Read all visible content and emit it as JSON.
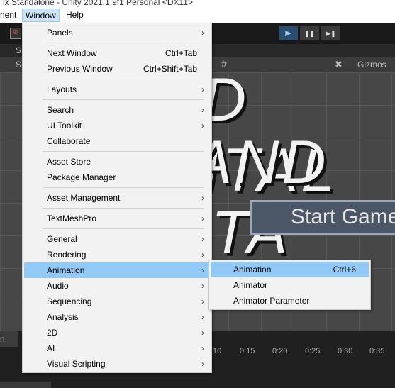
{
  "window_title": "ix Standalone - Unity 2021.1.9f1 Personal <DX11>",
  "menubar": [
    "nent",
    "Window",
    "Help"
  ],
  "toolbar": {
    "play": "▶",
    "pause": "❚❚",
    "step": "▶❚"
  },
  "scene": {
    "tab": "S",
    "gizmos": "Gizmos",
    "title_line1": "D ITAL",
    "title_line2": "AND ITA",
    "button": "Start Game"
  },
  "bottom": {
    "tab": "n",
    "ticks": [
      "10",
      "0:15",
      "0:20",
      "0:25",
      "0:30",
      "0:35"
    ]
  },
  "window_menu": {
    "items": [
      {
        "label": "Panels",
        "submenu": true
      },
      {
        "sep": true
      },
      {
        "label": "Next Window",
        "shortcut": "Ctrl+Tab"
      },
      {
        "label": "Previous Window",
        "shortcut": "Ctrl+Shift+Tab"
      },
      {
        "sep": true
      },
      {
        "label": "Layouts",
        "submenu": true
      },
      {
        "sep": true
      },
      {
        "label": "Search",
        "submenu": true
      },
      {
        "label": "UI Toolkit",
        "submenu": true
      },
      {
        "label": "Collaborate"
      },
      {
        "sep": true
      },
      {
        "label": "Asset Store"
      },
      {
        "label": "Package Manager"
      },
      {
        "sep": true
      },
      {
        "label": "Asset Management",
        "submenu": true
      },
      {
        "sep": true
      },
      {
        "label": "TextMeshPro",
        "submenu": true
      },
      {
        "sep": true
      },
      {
        "label": "General",
        "submenu": true
      },
      {
        "label": "Rendering",
        "submenu": true
      },
      {
        "label": "Animation",
        "submenu": true,
        "highlighted": true
      },
      {
        "label": "Audio",
        "submenu": true
      },
      {
        "label": "Sequencing",
        "submenu": true
      },
      {
        "label": "Analysis",
        "submenu": true
      },
      {
        "label": "2D",
        "submenu": true
      },
      {
        "label": "AI",
        "submenu": true
      },
      {
        "label": "Visual Scripting",
        "submenu": true
      }
    ]
  },
  "animation_submenu": {
    "items": [
      {
        "label": "Animation",
        "shortcut": "Ctrl+6",
        "highlighted": true
      },
      {
        "label": "Animator"
      },
      {
        "label": "Animator Parameter"
      }
    ]
  },
  "colors": {
    "highlight": "#91c9f7",
    "menu_bg": "#f2f2f2",
    "editor_bg": "#282828"
  }
}
